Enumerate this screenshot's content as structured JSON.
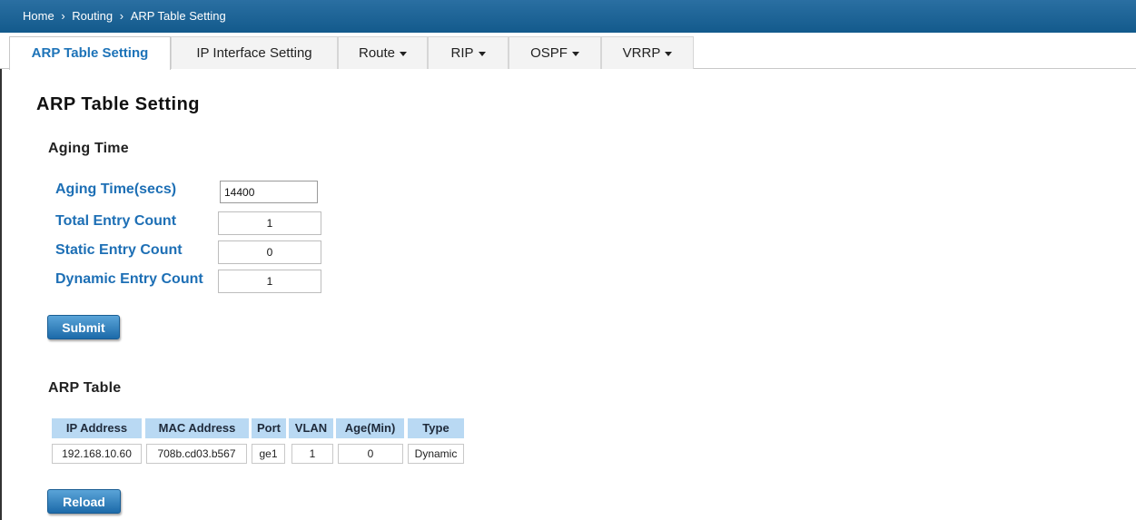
{
  "breadcrumb": {
    "home": "Home",
    "sep": "›",
    "routing": "Routing",
    "current": "ARP Table Setting"
  },
  "tabs": [
    {
      "label": "ARP Table Setting"
    },
    {
      "label": "IP Interface Setting"
    },
    {
      "label": "Route"
    },
    {
      "label": "RIP"
    },
    {
      "label": "OSPF"
    },
    {
      "label": "VRRP"
    }
  ],
  "page": {
    "title": "ARP Table Setting"
  },
  "aging": {
    "section_title": "Aging Time",
    "aging_time_label": "Aging Time(secs)",
    "aging_time_value": "14400",
    "total_label": "Total Entry Count",
    "total_value": "1",
    "static_label": "Static Entry Count",
    "static_value": "0",
    "dynamic_label": "Dynamic Entry Count",
    "dynamic_value": "1",
    "submit_label": "Submit"
  },
  "arp_table": {
    "section_title": "ARP Table",
    "columns": [
      "IP Address",
      "MAC Address",
      "Port",
      "VLAN",
      "Age(Min)",
      "Type"
    ],
    "rows": [
      [
        "192.168.10.60",
        "708b.cd03.b567",
        "ge1",
        "1",
        "0",
        "Dynamic"
      ]
    ],
    "reload_label": "Reload"
  },
  "colors": {
    "header_bar": "#135a8c",
    "label_blue": "#1d6fb5",
    "table_header": "#b9d9f3",
    "button": "#1c6aa9"
  }
}
